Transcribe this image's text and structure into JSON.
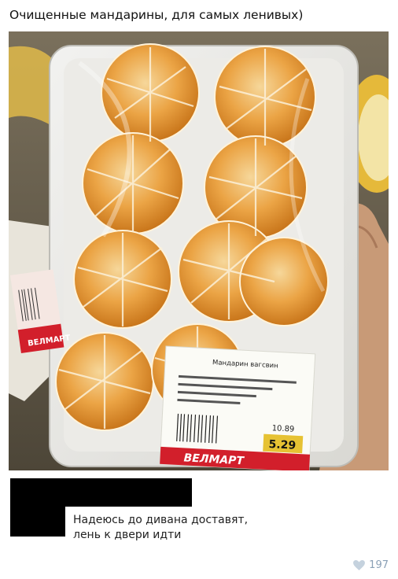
{
  "post": {
    "title": "Очищенные мандарины, для самых ленивых)",
    "image_alt": "photo-peeled-tangerines-in-tray"
  },
  "photo_labels": {
    "store_logo": "ВЕЛМАРТ",
    "side_sticker": "ВЕЛМАРТ",
    "product_name": "Мандарин вагсвин",
    "price_per_kg": "10.89",
    "price_total": "5.29"
  },
  "comment": {
    "line1": "Надеюсь до дивана доставят,",
    "line2": "лень к двери идти"
  },
  "likes": {
    "count": "197",
    "icon": "heart-icon"
  },
  "colors": {
    "likes": "#8aa0b6",
    "orange": "#e89a2c",
    "logo_red": "#d21f2b"
  }
}
